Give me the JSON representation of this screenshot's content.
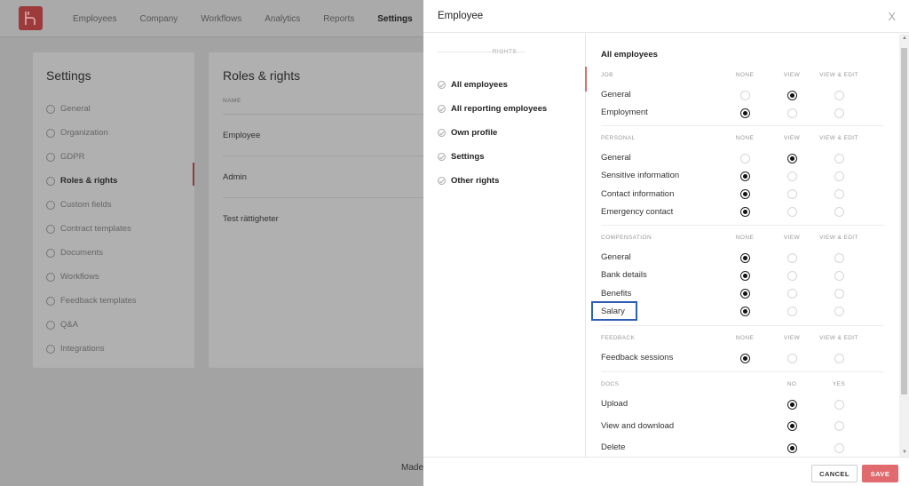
{
  "app": {
    "nav": [
      "Employees",
      "Company",
      "Workflows",
      "Analytics",
      "Reports",
      "Settings"
    ],
    "active_nav": "Settings"
  },
  "settings": {
    "title": "Settings",
    "items": [
      "General",
      "Organization",
      "GDPR",
      "Roles & rights",
      "Custom fields",
      "Contract templates",
      "Documents",
      "Workflows",
      "Feedback templates",
      "Q&A",
      "Integrations"
    ],
    "active": "Roles & rights"
  },
  "roles": {
    "title": "Roles & rights",
    "column": "NAME",
    "rows": [
      "Employee",
      "Admin",
      "Test rättigheter"
    ]
  },
  "footer_text": "Made",
  "modal": {
    "title": "Employee",
    "close": "X",
    "rights_label": "RIGHTS",
    "rights": [
      "All employees",
      "All reporting employees",
      "Own profile",
      "Settings",
      "Other rights"
    ],
    "active_right": "All employees",
    "section_heading": "All employees",
    "cols3": [
      "NONE",
      "VIEW",
      "VIEW & EDIT"
    ],
    "cols2": [
      "NO",
      "YES"
    ],
    "sections": [
      {
        "label": "JOB",
        "rows": [
          {
            "name": "General",
            "value": "VIEW"
          },
          {
            "name": "Employment",
            "value": "NONE"
          }
        ]
      },
      {
        "label": "PERSONAL",
        "rows": [
          {
            "name": "General",
            "value": "VIEW"
          },
          {
            "name": "Sensitive information",
            "value": "NONE"
          },
          {
            "name": "Contact information",
            "value": "NONE"
          },
          {
            "name": "Emergency contact",
            "value": "NONE"
          }
        ]
      },
      {
        "label": "COMPENSATION",
        "rows": [
          {
            "name": "General",
            "value": "NONE"
          },
          {
            "name": "Bank details",
            "value": "NONE"
          },
          {
            "name": "Benefits",
            "value": "NONE"
          },
          {
            "name": "Salary",
            "value": "NONE"
          }
        ]
      },
      {
        "label": "FEEDBACK",
        "rows": [
          {
            "name": "Feedback sessions",
            "value": "NONE"
          }
        ]
      },
      {
        "label": "DOCS",
        "rows": [
          {
            "name": "Upload",
            "value": "NO"
          },
          {
            "name": "View and download",
            "value": "NO"
          },
          {
            "name": "Delete",
            "value": "NO"
          }
        ]
      }
    ],
    "cancel_label": "CANCEL",
    "save_label": "SAVE"
  },
  "colors": {
    "accent": "#e06a6e",
    "highlight": "#2d5fb5"
  }
}
